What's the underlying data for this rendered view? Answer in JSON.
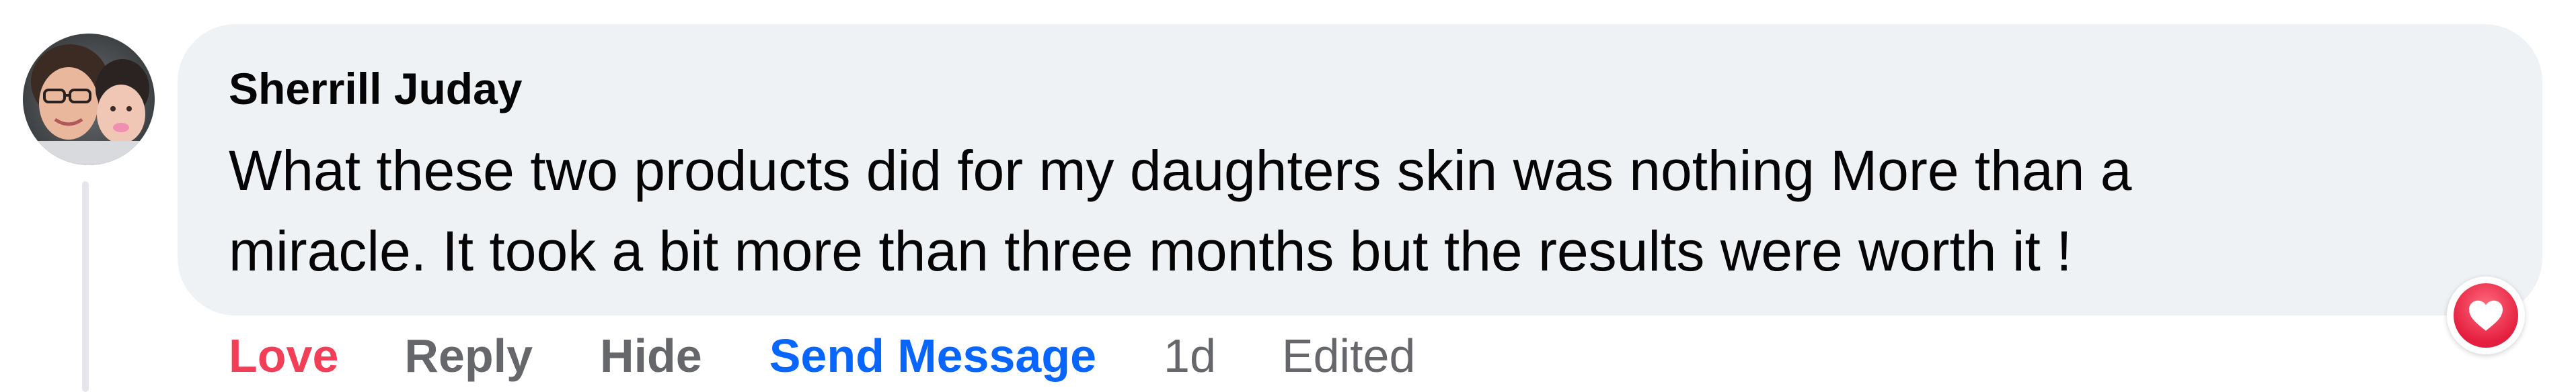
{
  "comment": {
    "author": "Sherrill Juday",
    "text_lines": [
      "What these two products did for my daughters skin was nothing More than a",
      "miracle. It took a bit more than three months but the results were worth it !"
    ]
  },
  "actions": {
    "love": "Love",
    "reply": "Reply",
    "hide": "Hide",
    "send_message": "Send Message",
    "time": "1d",
    "edited": "Edited"
  },
  "reaction": {
    "type": "love",
    "icon": "heart-icon",
    "color": "#f33e58"
  },
  "colors": {
    "bubble": "#eff2f5",
    "love_action": "#f33e58",
    "send_message_action": "#0866ff",
    "muted_text": "#65676b"
  }
}
